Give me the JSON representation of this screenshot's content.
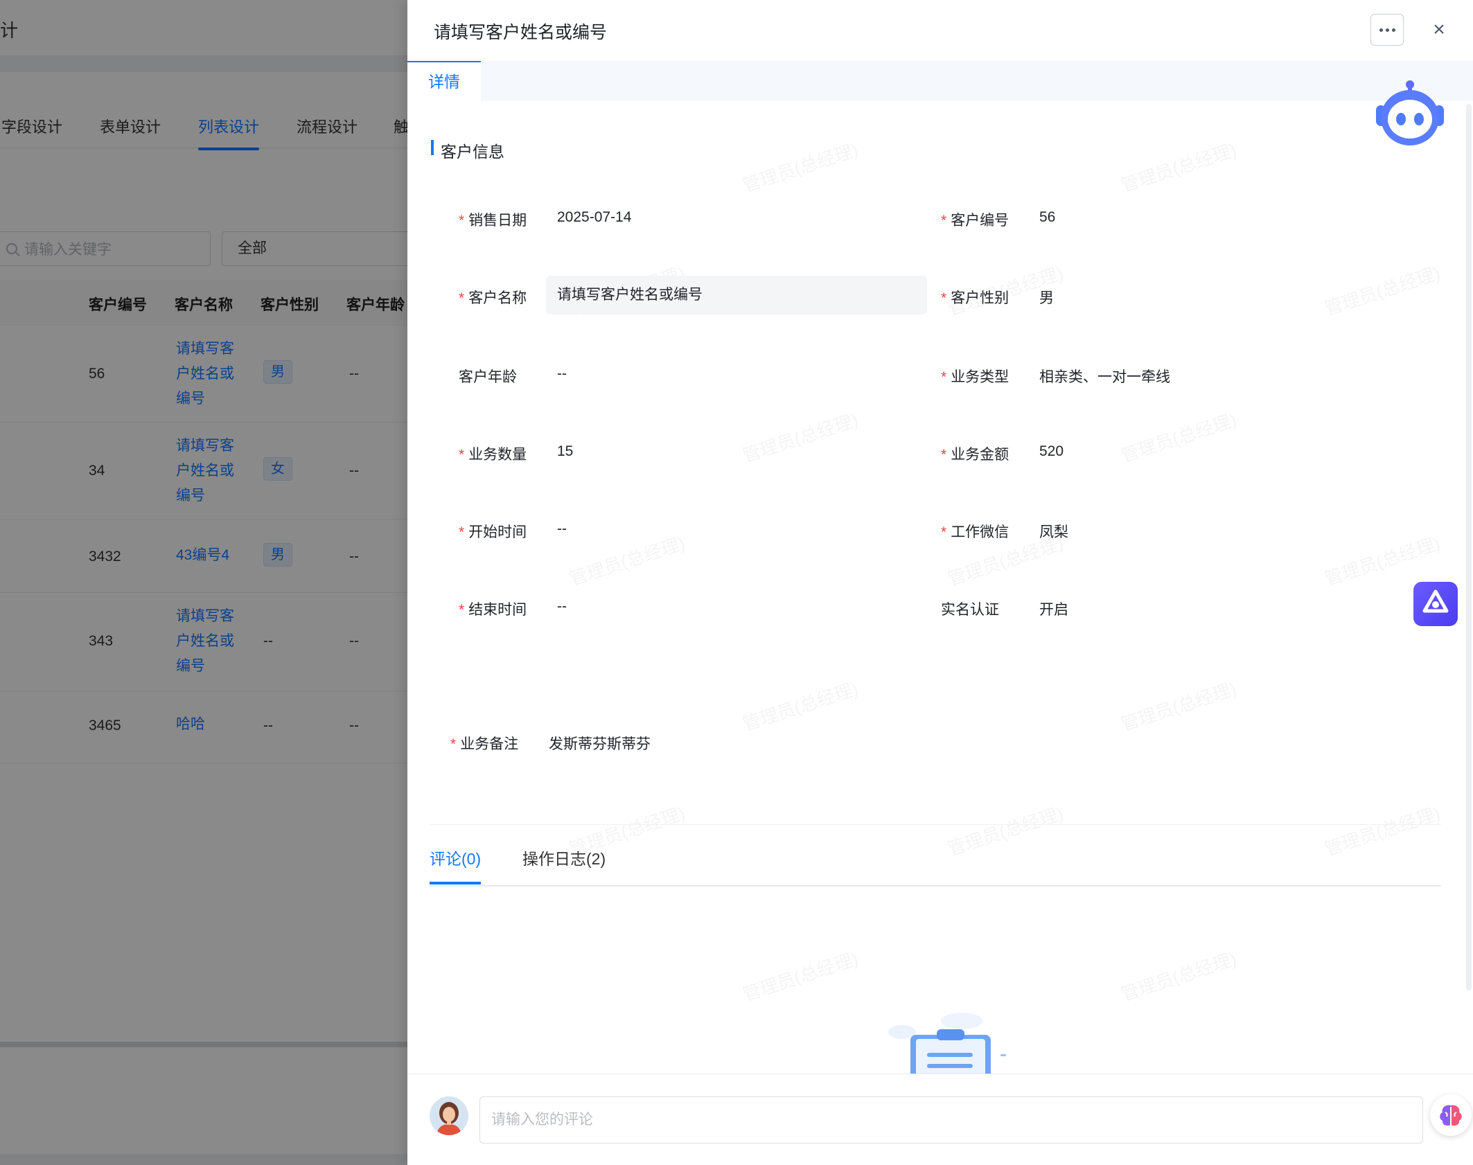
{
  "background": {
    "title_fragment": "计",
    "tabs": [
      "字段设计",
      "表单设计",
      "列表设计",
      "流程设计",
      "触"
    ],
    "active_tab": 2,
    "search_placeholder": "请输入关键字",
    "select_value": "全部",
    "table": {
      "headers": [
        "客户编号",
        "客户名称",
        "客户性别",
        "客户年龄"
      ],
      "rows": [
        {
          "id": "56",
          "name": "请填写客户姓名或编号",
          "gender": "男",
          "age": "--"
        },
        {
          "id": "34",
          "name": "请填写客户姓名或编号",
          "gender": "女",
          "age": "--"
        },
        {
          "id": "3432",
          "name": "43编号4",
          "gender": "男",
          "age": "--"
        },
        {
          "id": "343",
          "name": "请填写客户姓名或编号",
          "gender": "--",
          "age": "--"
        },
        {
          "id": "3465",
          "name": "哈哈",
          "gender": "--",
          "age": "--"
        }
      ]
    }
  },
  "drawer": {
    "title": "请填写客户姓名或编号",
    "more_icon": "ellipsis-icon",
    "close_label": "×",
    "tab": "详情",
    "section_title": "客户信息",
    "fields": {
      "sale_date": {
        "label": "销售日期",
        "value": "2025-07-14",
        "required": "*"
      },
      "customer_id": {
        "label": "客户编号",
        "value": "56",
        "required": "*"
      },
      "customer_name": {
        "label": "客户名称",
        "value": "请填写客户姓名或编号",
        "required": "*"
      },
      "customer_gender": {
        "label": "客户性别",
        "value": "男",
        "required": "*"
      },
      "customer_age": {
        "label": "客户年龄",
        "value": "--"
      },
      "business_type": {
        "label": "业务类型",
        "value": "相亲类、一对一牵线",
        "required": "*"
      },
      "business_qty": {
        "label": "业务数量",
        "value": "15",
        "required": "*"
      },
      "business_amount": {
        "label": "业务金额",
        "value": "520",
        "required": "*"
      },
      "start_time": {
        "label": "开始时间",
        "value": "--",
        "required": "*"
      },
      "work_wechat": {
        "label": "工作微信",
        "value": "凤梨",
        "required": "*"
      },
      "end_time": {
        "label": "结束时间",
        "value": "--",
        "required": "*"
      },
      "real_name": {
        "label": "实名认证",
        "value": "开启"
      },
      "remark": {
        "label": "业务备注",
        "value": "发斯蒂芬斯蒂芬",
        "required": "*"
      }
    },
    "bottom_tabs": [
      "评论(0)",
      "操作日志(2)"
    ],
    "comment_placeholder": "请输入您的评论",
    "watermark": "管理员(总经理)"
  },
  "colors": {
    "accent": "#1677ff",
    "required": "#f53f3f",
    "mask": "rgba(0,0,0,0.46)"
  }
}
